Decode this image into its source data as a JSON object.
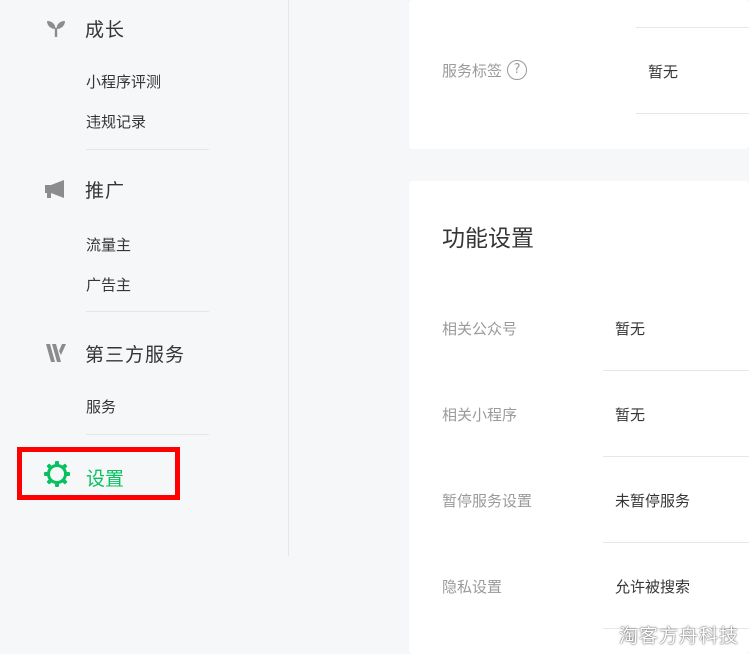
{
  "sidebar": {
    "growth": {
      "label": "成长",
      "icon": "sprout-icon",
      "items": [
        "小程序评测",
        "违规记录"
      ]
    },
    "promotion": {
      "label": "推广",
      "icon": "megaphone-icon",
      "items": [
        "流量主",
        "广告主"
      ]
    },
    "third_party": {
      "label": "第三方服务",
      "icon": "third-party-logo-icon",
      "items": [
        "服务"
      ]
    },
    "settings": {
      "label": "设置",
      "icon": "gear-icon",
      "highlight_color": "#ff0000",
      "accent_color": "#07c160"
    }
  },
  "top_card": {
    "service_tags_label": "服务标签",
    "service_tags_value": "暂无"
  },
  "features": {
    "title": "功能设置",
    "rows": [
      {
        "label": "相关公众号",
        "value": "暂无"
      },
      {
        "label": "相关小程序",
        "value": "暂无"
      },
      {
        "label": "暂停服务设置",
        "value": "未暂停服务"
      },
      {
        "label": "隐私设置",
        "value": "允许被搜索"
      }
    ]
  },
  "watermark": "淘客方舟科技"
}
